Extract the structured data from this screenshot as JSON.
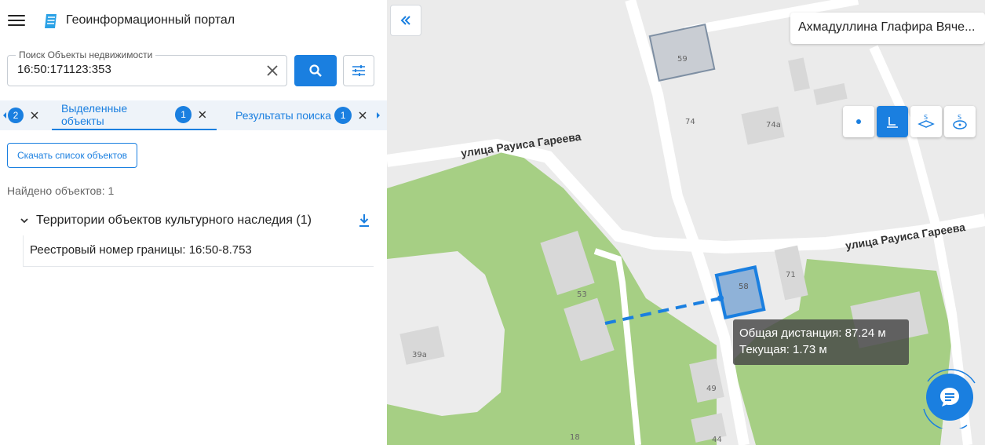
{
  "header": {
    "title": "Геоинформационный портал"
  },
  "search": {
    "label": "Поиск Объекты недвижимости",
    "value": "16:50:171123:353"
  },
  "tabs": [
    {
      "badge": "2"
    },
    {
      "label": "Выделенные объекты",
      "badge": "1"
    },
    {
      "label": "Результаты поиска",
      "badge": "1"
    }
  ],
  "results": {
    "download_label": "Скачать список объектов",
    "found_text": "Найдено объектов: 1",
    "group_title": "Территории объектов культурного наследия (1)",
    "record": "Реестровый номер границы: 16:50-8.753"
  },
  "map": {
    "user_name": "Ахмадуллина Глафира Вяче...",
    "tooltip_total": "Общая дистанция: 87.24 м",
    "tooltip_current": "Текущая: 1.73 м",
    "streets": {
      "left": "улица Рауиса Гареева",
      "right": "улица Рауиса Гареева"
    },
    "house_numbers": [
      "59",
      "74",
      "74а",
      "71",
      "58",
      "53",
      "39а",
      "49",
      "18",
      "44"
    ],
    "tools": [
      "point-tool-icon",
      "line-tool-icon",
      "area-tool-icon",
      "circle-tool-icon"
    ]
  },
  "colors": {
    "accent": "#1a7fe0",
    "park": "#a6cf84",
    "road": "#ffffff",
    "map_bg": "#ebebeb"
  }
}
